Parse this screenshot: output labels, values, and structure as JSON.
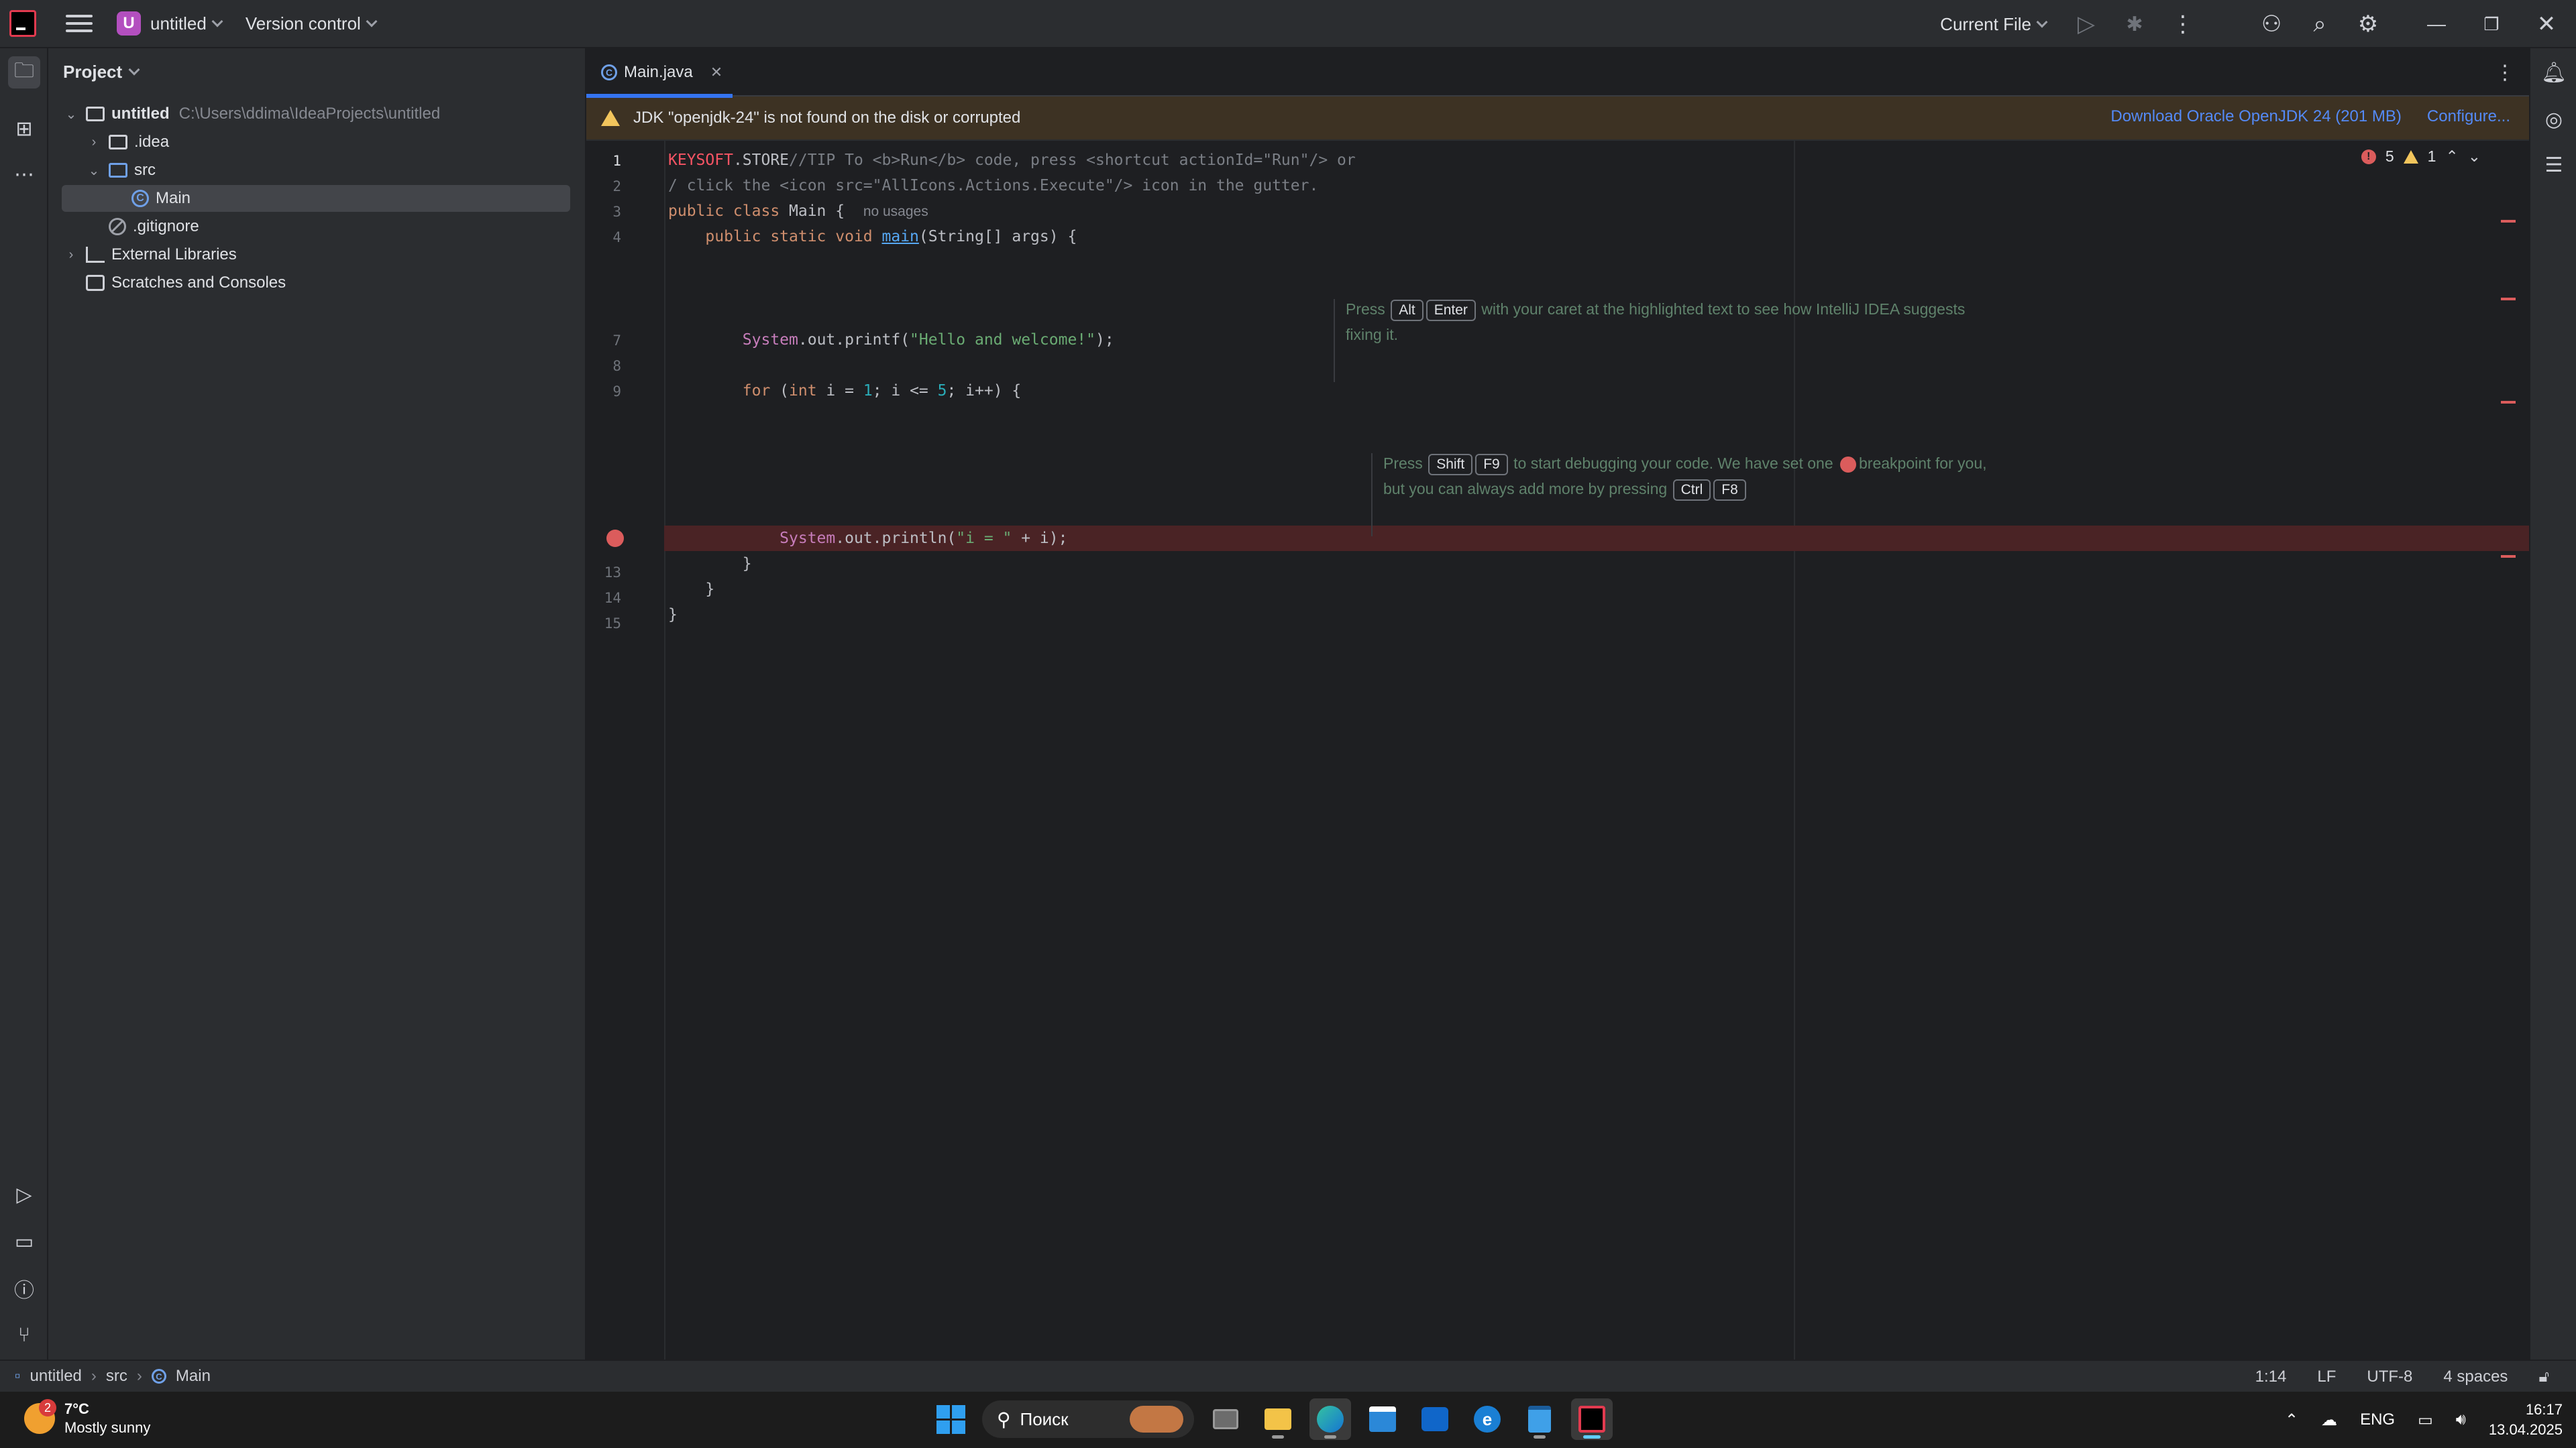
{
  "titlebar": {
    "project_badge": "U",
    "project_name": "untitled",
    "vcs_label": "Version control",
    "run_config": "Current File"
  },
  "project_panel": {
    "title": "Project",
    "tree": [
      {
        "label": "untitled",
        "path": "C:\\Users\\ddima\\IdeaProjects\\untitled"
      },
      {
        "label": ".idea"
      },
      {
        "label": "src"
      },
      {
        "label": "Main"
      },
      {
        "label": ".gitignore"
      },
      {
        "label": "External Libraries"
      },
      {
        "label": "Scratches and Consoles"
      }
    ]
  },
  "editor": {
    "tab_label": "Main.java",
    "banner_text": "JDK \"openjdk-24\" is not found on the disk or corrupted",
    "banner_link_download": "Download Oracle OpenJDK 24 (201 MB)",
    "banner_link_configure": "Configure...",
    "inspection_errors": "5",
    "inspection_warnings": "1",
    "line_numbers": [
      "1",
      "2",
      "3",
      "4",
      "7",
      "8",
      "9",
      "13",
      "14",
      "15"
    ],
    "lines": {
      "l1_a": "KEYSOFT",
      "l1_b": ".STORE",
      "l1_c": "//TIP To <b>Run</b> code, press <shortcut actionId=\"Run\"/> or",
      "l2": "/ click the <icon src=\"AllIcons.Actions.Execute\"/> icon in the gutter.",
      "l3_kw": "public class",
      "l3_name": " Main {",
      "l3_hint": "no usages",
      "l4_kw": "public static void",
      "l4_fn": "main",
      "l4_rest": "(String[] args) {",
      "l7_sys": "System",
      "l7_out": ".out.printf(",
      "l7_str": "\"Hello and welcome!\"",
      "l7_end": ");",
      "l9_kw": "for",
      "l9_a": " (",
      "l9_int": "int",
      "l9_b": " i = ",
      "l9_n1": "1",
      "l9_c": "; i <= ",
      "l9_n2": "5",
      "l9_d": "; i++) {",
      "l12_sys": "System",
      "l12_out": ".out.println(",
      "l12_str": "\"i = \"",
      "l12_end": " + i);",
      "l13": "}",
      "l14": "}",
      "l15": "}"
    },
    "tip1": {
      "press": "Press",
      "key1": "Alt",
      "key2": "Enter",
      "text1": "with your caret at the highlighted text to see how IntelliJ IDEA suggests",
      "text2": "fixing it."
    },
    "tip2": {
      "press": "Press",
      "key1": "Shift",
      "key2": "F9",
      "text1a": "to start debugging your code. We have set one",
      "text1b": "breakpoint for you,",
      "text2": "but you can always add more by pressing",
      "key3": "Ctrl",
      "key4": "F8"
    }
  },
  "statusbar": {
    "crumbs": [
      "untitled",
      "src",
      "Main"
    ],
    "position": "1:14",
    "line_sep": "LF",
    "encoding": "UTF-8",
    "indent": "4 spaces"
  },
  "taskbar": {
    "weather_badge": "2",
    "temperature": "7°C",
    "condition": "Mostly sunny",
    "search_placeholder": "Поиск",
    "language": "ENG",
    "time": "16:17",
    "date": "13.04.2025"
  },
  "colors": {
    "accent": "#3574f0",
    "breakpoint": "#db5c5c",
    "warning_banner": "#3d3223"
  }
}
